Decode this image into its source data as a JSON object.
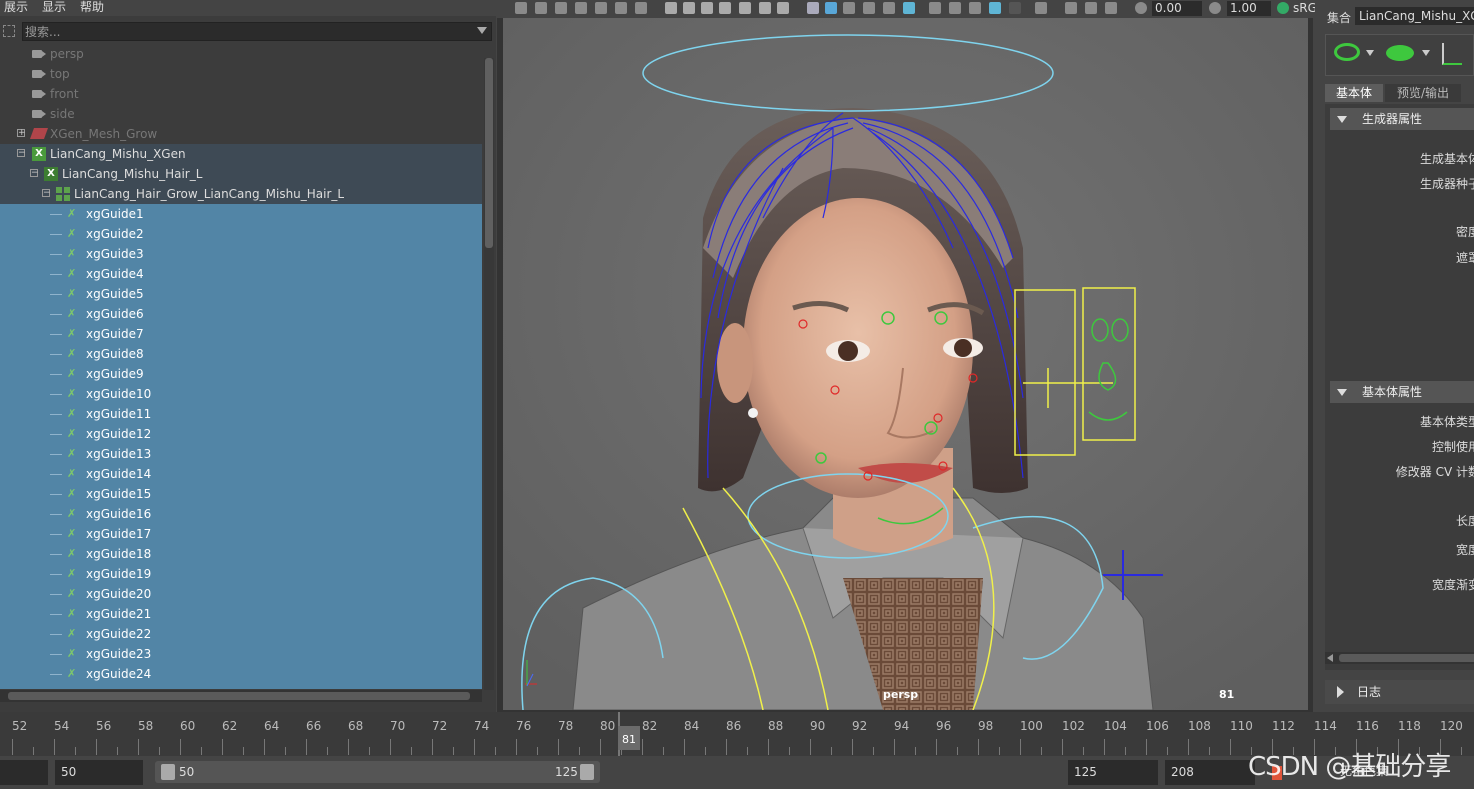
{
  "menu": {
    "items": [
      "展示",
      "显示",
      "帮助"
    ]
  },
  "outliner": {
    "search_placeholder": "搜索...",
    "cameras": [
      "persp",
      "top",
      "front",
      "side"
    ],
    "xgen_mesh_grow": "XGen_Mesh_Grow",
    "collection": "LianCang_Mishu_XGen",
    "description": "LianCang_Mishu_Hair_L",
    "grow": "LianCang_Hair_Grow_LianCang_Mishu_Hair_L",
    "guides": [
      "xgGuide1",
      "xgGuide2",
      "xgGuide3",
      "xgGuide4",
      "xgGuide5",
      "xgGuide6",
      "xgGuide7",
      "xgGuide8",
      "xgGuide9",
      "xgGuide10",
      "xgGuide11",
      "xgGuide12",
      "xgGuide13",
      "xgGuide14",
      "xgGuide15",
      "xgGuide16",
      "xgGuide17",
      "xgGuide18",
      "xgGuide19",
      "xgGuide20",
      "xgGuide21",
      "xgGuide22",
      "xgGuide23",
      "xgGuide24"
    ]
  },
  "viewport": {
    "exposure": "0.00",
    "gamma": "1.00",
    "colorspace": "sRGB",
    "camera_name": "persp",
    "current_frame": "81"
  },
  "attr_editor": {
    "set_label": "集合",
    "set_value": "LianCang_Mishu_XGen",
    "tabs": [
      "基本体",
      "预览/输出"
    ],
    "section_generator": "生成器属性",
    "generator_fields": [
      "生成基本体",
      "生成器种子",
      "密度",
      "遮罩"
    ],
    "section_primitive": "基本体属性",
    "primitive_fields": [
      "基本体类型",
      "控制使用",
      "修改器 CV 计数",
      "长度",
      "宽度",
      "宽度渐变"
    ],
    "section_log": "日志"
  },
  "timeline": {
    "ticks": [
      "52",
      "54",
      "56",
      "58",
      "60",
      "62",
      "64",
      "66",
      "68",
      "70",
      "72",
      "74",
      "76",
      "78",
      "80",
      "82",
      "84",
      "86",
      "88",
      "90",
      "92",
      "94",
      "96",
      "98",
      "100",
      "102",
      "104",
      "106",
      "108",
      "110",
      "112",
      "114",
      "116",
      "118",
      "120"
    ],
    "current": "81"
  },
  "range": {
    "start": "50",
    "slider_start": "50",
    "slider_end": "125",
    "end": "125",
    "anim_end": "208",
    "char_set": "无角色集"
  },
  "watermark": "CSDN @基础分享",
  "colors": {
    "selection": "#5285a6",
    "xgen_green": "#4a9a3c",
    "curve_cyan": "#7fd4ee",
    "guide_blue": "#2a2ae0",
    "ctrl_yellow": "#f0f04a"
  }
}
